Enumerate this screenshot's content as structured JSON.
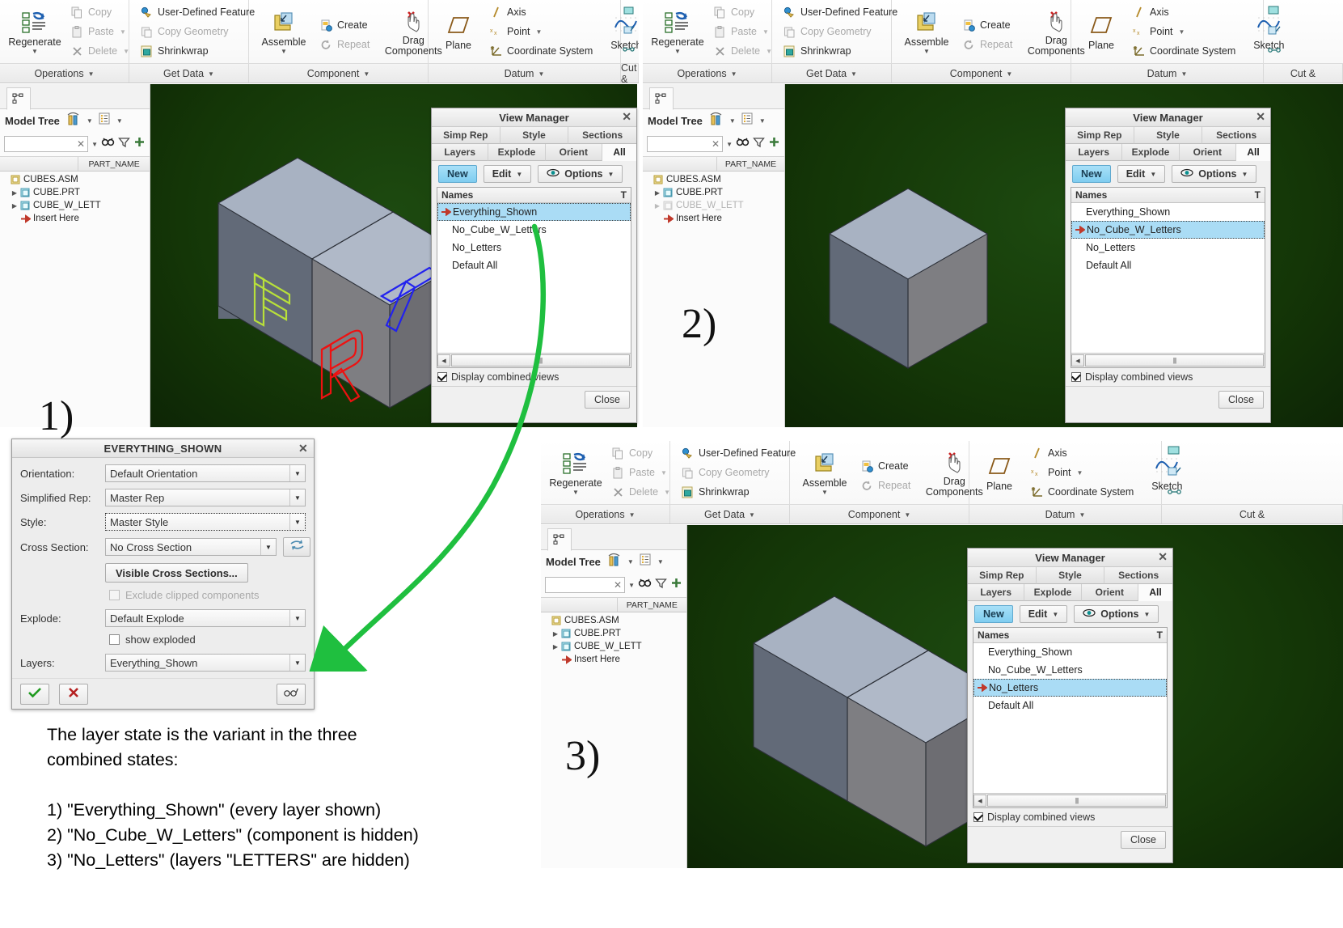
{
  "ribbon": {
    "groups": [
      {
        "tab": "Operations",
        "big": [
          {
            "label": "Regenerate",
            "icon": "regenerate-icon",
            "caret": true
          }
        ],
        "small": [
          {
            "label": "Copy",
            "icon": "copy-icon",
            "disabled": true,
            "caret": false
          },
          {
            "label": "Paste",
            "icon": "paste-icon",
            "disabled": true,
            "caret": true
          },
          {
            "label": "Delete",
            "icon": "delete-icon",
            "disabled": true,
            "caret": true
          }
        ]
      },
      {
        "tab": "Get Data",
        "big": [],
        "small": [
          {
            "label": "User-Defined Feature",
            "icon": "udf-icon",
            "disabled": false,
            "caret": false
          },
          {
            "label": "Copy Geometry",
            "icon": "copy-geometry-icon",
            "disabled": true,
            "caret": false
          },
          {
            "label": "Shrinkwrap",
            "icon": "shrinkwrap-icon",
            "disabled": false,
            "caret": false
          }
        ]
      },
      {
        "tab": "Component",
        "big": [
          {
            "label": "Assemble",
            "icon": "assemble-icon",
            "caret": true
          },
          {
            "label": "Drag Components",
            "icon": "drag-components-icon",
            "caret": false
          }
        ],
        "small": [
          {
            "label": "Create",
            "icon": "create-icon",
            "disabled": false,
            "caret": false
          },
          {
            "label": "Repeat",
            "icon": "repeat-icon",
            "disabled": true,
            "caret": false
          }
        ]
      },
      {
        "tab": "Datum",
        "big": [
          {
            "label": "Plane",
            "icon": "plane-icon",
            "caret": false
          },
          {
            "label": "Sketch",
            "icon": "sketch-icon",
            "caret": false
          }
        ],
        "small": [
          {
            "label": "Axis",
            "icon": "axis-icon",
            "disabled": false,
            "caret": false
          },
          {
            "label": "Point",
            "icon": "point-icon",
            "disabled": false,
            "caret": true
          },
          {
            "label": "Coordinate System",
            "icon": "coordinate-system-icon",
            "disabled": false,
            "caret": false
          }
        ]
      },
      {
        "tab": "Cut &",
        "big": [],
        "small": []
      }
    ]
  },
  "model_tree": {
    "title": "Model Tree",
    "search_value": "",
    "column_header": "PART_NAME",
    "rows_full": [
      {
        "label": "CUBES.ASM",
        "indent": 0,
        "expander": false,
        "icon": "assembly-icon",
        "dim": false
      },
      {
        "label": "CUBE.PRT",
        "indent": 1,
        "expander": true,
        "icon": "part-icon",
        "dim": false
      },
      {
        "label": "CUBE_W_LETT",
        "indent": 1,
        "expander": true,
        "icon": "part-icon",
        "dim": false
      },
      {
        "label": "Insert Here",
        "indent": 2,
        "expander": false,
        "icon": "insert-here-icon",
        "dim": false
      }
    ],
    "rows_hidden_cube": [
      {
        "label": "CUBES.ASM",
        "indent": 0,
        "expander": false,
        "icon": "assembly-icon",
        "dim": false
      },
      {
        "label": "CUBE.PRT",
        "indent": 1,
        "expander": true,
        "icon": "part-icon",
        "dim": false
      },
      {
        "label": "CUBE_W_LETT",
        "indent": 1,
        "expander": true,
        "icon": "part-icon",
        "dim": true
      },
      {
        "label": "Insert Here",
        "indent": 2,
        "expander": false,
        "icon": "insert-here-icon",
        "dim": false
      }
    ]
  },
  "view_manager": {
    "title": "View Manager",
    "tabs_row1": [
      "Simp Rep",
      "Style",
      "Sections"
    ],
    "tabs_row2": [
      "Layers",
      "Explode",
      "Orient",
      "All"
    ],
    "active_tab": "All",
    "buttons": {
      "new": "New",
      "edit": "Edit",
      "options": "Options"
    },
    "list_header": "Names",
    "list_header_right": "T",
    "items": [
      "Everything_Shown",
      "No_Cube_W_Letters",
      "No_Letters",
      "Default All"
    ],
    "checkbox_label": "Display combined views",
    "checkbox_checked": true,
    "close_label": "Close",
    "selected_panel1": "Everything_Shown",
    "selected_panel2": "No_Cube_W_Letters",
    "selected_panel3": "No_Letters"
  },
  "properties_dialog": {
    "title": "EVERYTHING_SHOWN",
    "fields": [
      {
        "label": "Orientation:",
        "value": "Default Orientation",
        "focus": false
      },
      {
        "label": "Simplified Rep:",
        "value": "Master Rep",
        "focus": false
      },
      {
        "label": "Style:",
        "value": "Master Style",
        "focus": true
      }
    ],
    "cross_section": {
      "label": "Cross Section:",
      "value": "No Cross Section"
    },
    "visible_cross_sections_button": "Visible Cross Sections...",
    "exclude_clipped_label": "Exclude clipped components",
    "exclude_clipped_checked": false,
    "explode": {
      "label": "Explode:",
      "value": "Default Explode"
    },
    "show_exploded_label": "show exploded",
    "show_exploded_checked": false,
    "layers": {
      "label": "Layers:",
      "value": "Everything_Shown"
    },
    "ok_icon": "check-icon",
    "cancel_icon": "cross-icon",
    "preview_icon": "glasses-icon"
  },
  "steps": {
    "one": "1)",
    "two": "2)",
    "three": "3)"
  },
  "caption": {
    "intro_line1": "The layer state is the variant in the three",
    "intro_line2": "combined states:",
    "line1": "1) \"Everything_Shown\" (every layer shown)",
    "line2": "2) \"No_Cube_W_Letters\" (component is hidden)",
    "line3": "3) \"No_Letters\" (layers \"LETTERS\" are hidden)"
  },
  "model": {
    "letters": [
      {
        "char": "T",
        "color": "#2222ee",
        "face": "top"
      },
      {
        "char": "F",
        "color": "#b8e03a",
        "face": "front"
      },
      {
        "char": "R",
        "color": "#ee1111",
        "face": "right"
      }
    ],
    "face_colors": {
      "top": "#a8b2c2",
      "top2": "#b0b9c8",
      "front_left": "#626a78",
      "front_right": "#7e7e82",
      "right": "#6d6d72"
    }
  },
  "colors": {
    "viewport_bg": "#143607",
    "selection": "#aadcf5",
    "accent": "#7fcdf0",
    "annotation_arrow": "#1fbf3f"
  }
}
